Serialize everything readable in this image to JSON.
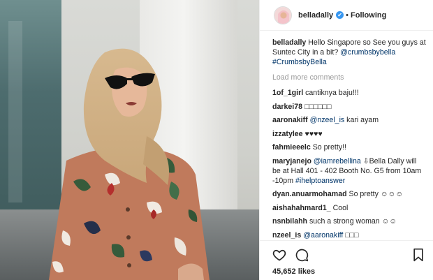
{
  "post": {
    "username": "belladally",
    "verified_badge": "✔",
    "separator": "•",
    "follow_status": "Following",
    "caption": {
      "user": "belladally",
      "text": "Hello Singapore so See you guys at Suntec City in a bit?",
      "mention": "@crumbsbybella",
      "hashtag": "#CrumbsbyBella"
    },
    "load_more": "Load more comments",
    "comments": [
      {
        "user": "1of_1girl",
        "text": "cantiknya baju!!!"
      },
      {
        "user": "darkei78",
        "text": "□□□□□□"
      },
      {
        "user": "aaronakiff",
        "mention": "@nzeel_is",
        "text": "kari ayam"
      },
      {
        "user": "izzatylee",
        "text": "♥♥♥♥"
      },
      {
        "user": "fahmieeelc",
        "text": "So pretty!!"
      },
      {
        "user": "maryjanejo",
        "mention": "@iamrebellina",
        "text": "⇩Bella Dally will be at Hall 401 - 402 Booth No. G5 from 10am -10pm",
        "hashtag": "#ihelptoanswer"
      },
      {
        "user": "dyan.anuarmohamad",
        "text": "So pretty ☺☺☺"
      },
      {
        "user": "aishahahmard1_",
        "text": "Cool"
      },
      {
        "user": "nsnbilahh",
        "text": "such a strong woman ☺☺"
      },
      {
        "user": "nzeel_is",
        "mention": "@aaronakiff",
        "text": "□□□"
      }
    ],
    "likes": "45,652 likes",
    "icons": [
      "heart-icon",
      "comment-icon",
      "bookmark-icon"
    ]
  }
}
